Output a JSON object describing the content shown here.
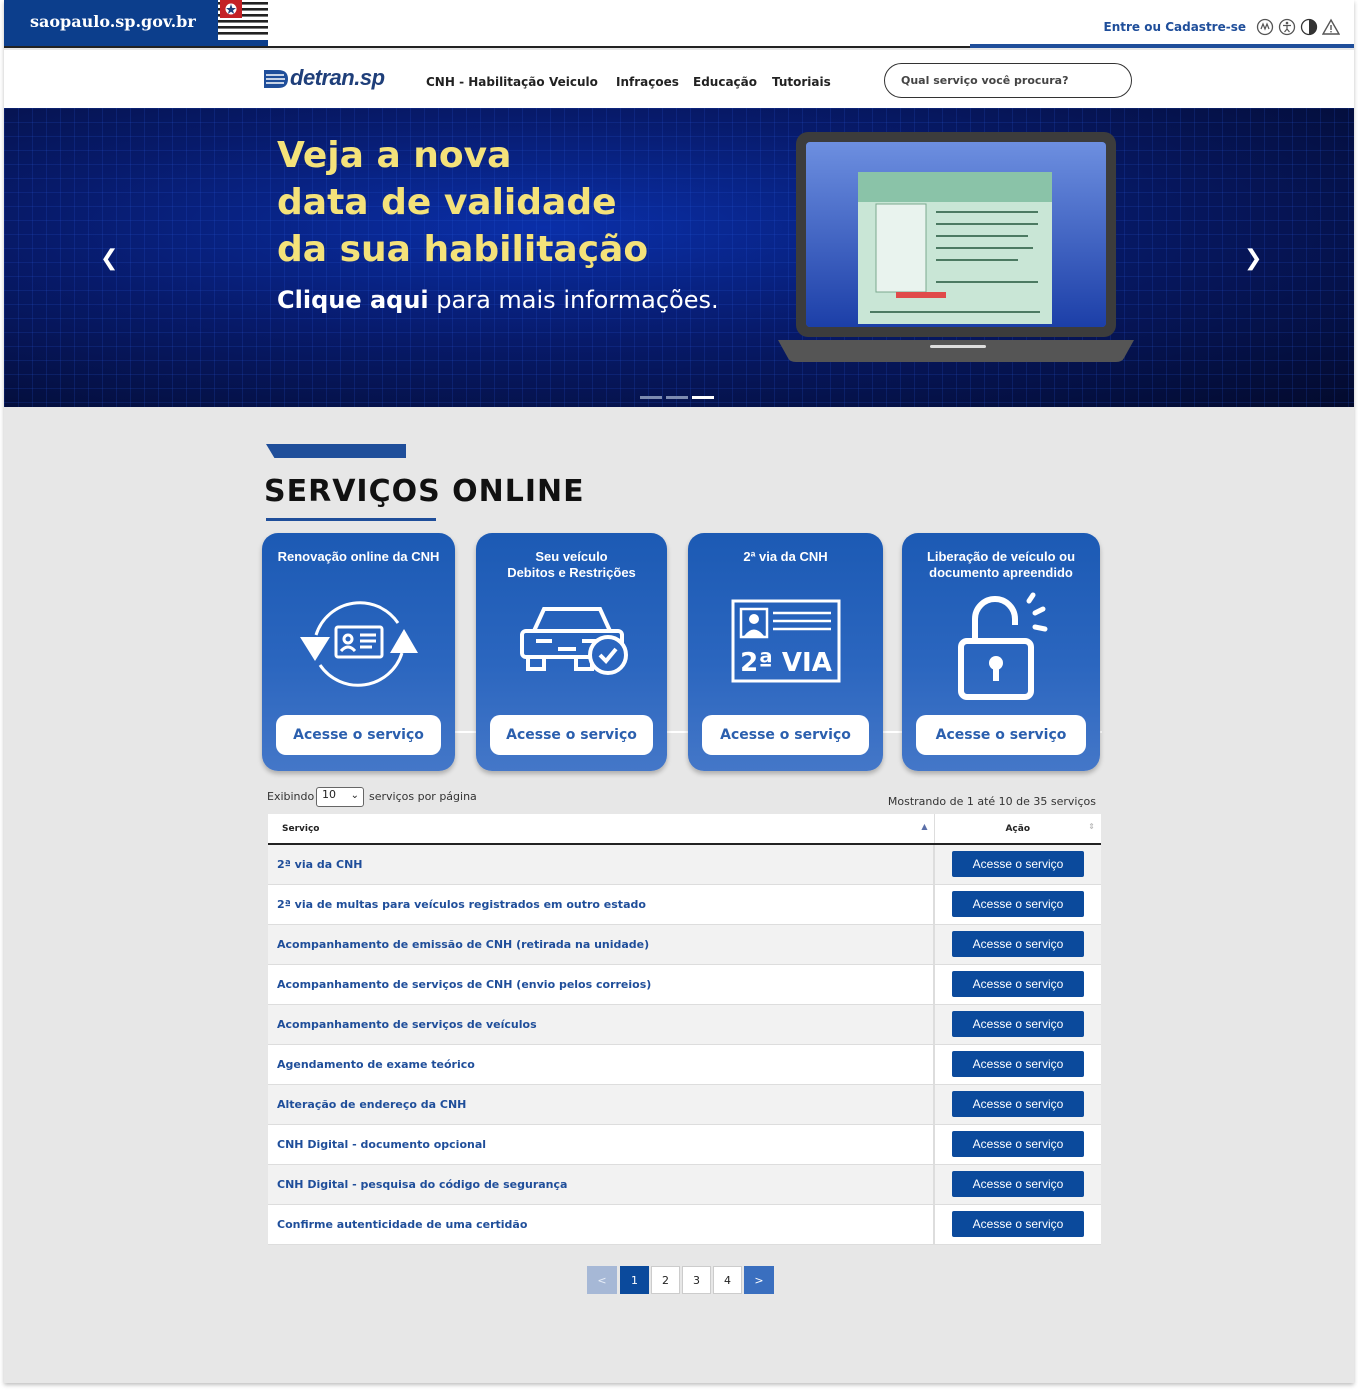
{
  "gov": {
    "site": "saopaulo.sp.gov.br",
    "login_label": "Entre ou Cadastre-se"
  },
  "nav": {
    "brand": "detran.sp",
    "links": [
      "CNH - Habilitação",
      "Veiculo",
      "Infraçoes",
      "Educação",
      "Tutoriais"
    ],
    "search_placeholder": "Qual serviço você procura?"
  },
  "hero": {
    "headline_lines": [
      "Veja a nova",
      "data de validade",
      "da sua habilitação"
    ],
    "cta_bold": "Clique aqui",
    "cta_rest": " para mais informações.",
    "slide_count": 3,
    "active_slide": 3
  },
  "section": {
    "title": "SERVIÇOS ONLINE"
  },
  "cards": [
    {
      "title": "Renovação online da CNH",
      "button": "Acesse o serviço",
      "icon": "renewal-icon"
    },
    {
      "title": "Seu veículo\nDebitos e Restrições",
      "button": "Acesse o serviço",
      "icon": "car-check-icon"
    },
    {
      "title": "2ª via da CNH",
      "button": "Acesse o serviço",
      "icon": "second-copy-icon"
    },
    {
      "title": "Liberação de veículo ou\ndocumento apreendido",
      "button": "Acesse o serviço",
      "icon": "unlock-icon"
    }
  ],
  "table": {
    "length_prefix": "Exibindo",
    "length_value": "10",
    "length_suffix": "serviços por página",
    "info": "Mostrando de 1 até 10 de 35 serviços",
    "headers": {
      "service": "Serviço",
      "action": "Ação"
    },
    "rows": [
      {
        "service": "2ª via da CNH",
        "action": "Acesse o serviço"
      },
      {
        "service": "2ª via de multas para veículos registrados em outro estado",
        "action": "Acesse o serviço"
      },
      {
        "service": "Acompanhamento de emissão de CNH (retirada na unidade)",
        "action": "Acesse o serviço"
      },
      {
        "service": "Acompanhamento de serviços de CNH (envio pelos correios)",
        "action": "Acesse o serviço"
      },
      {
        "service": "Acompanhamento de serviços de veículos",
        "action": "Acesse o serviço"
      },
      {
        "service": "Agendamento de exame teórico",
        "action": "Acesse o serviço"
      },
      {
        "service": "Alteração de endereço da CNH",
        "action": "Acesse o serviço"
      },
      {
        "service": "CNH Digital - documento opcional",
        "action": "Acesse o serviço"
      },
      {
        "service": "CNH Digital - pesquisa do código de segurança",
        "action": "Acesse o serviço"
      },
      {
        "service": "Confirme autenticidade de uma certidão",
        "action": "Acesse o serviço"
      }
    ]
  },
  "pagination": {
    "prev": "<",
    "pages": [
      "1",
      "2",
      "3",
      "4"
    ],
    "current": "1",
    "next": ">"
  },
  "colors": {
    "primary": "#0b4a9c",
    "gov_blue": "#0c3e8c",
    "headline": "#f4e27a",
    "page_bg": "#e7e7e7"
  }
}
